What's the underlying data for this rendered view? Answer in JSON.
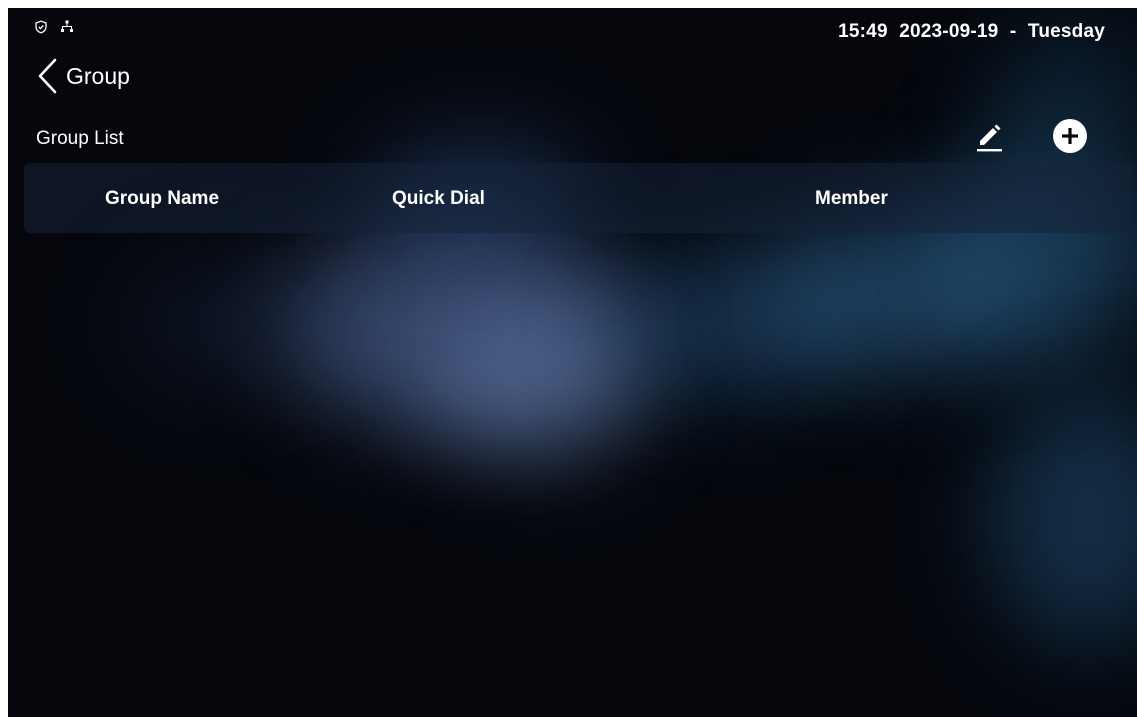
{
  "status_bar": {
    "icons": [
      "shield-icon",
      "network-icon"
    ],
    "time": "15:49",
    "date": "2023-09-19",
    "separator": "-",
    "weekday": "Tuesday"
  },
  "header": {
    "back_icon": "chevron-left-icon",
    "title": "Group"
  },
  "group_list": {
    "title": "Group List",
    "edit_icon": "pencil-icon",
    "add_icon": "plus-circle-icon",
    "columns": [
      "Group Name",
      "Quick Dial",
      "Member"
    ],
    "rows": []
  },
  "colors": {
    "background": "#05070d",
    "text": "#ffffff",
    "header_row": "#162238",
    "accent_blue": "#3f6ea8"
  }
}
